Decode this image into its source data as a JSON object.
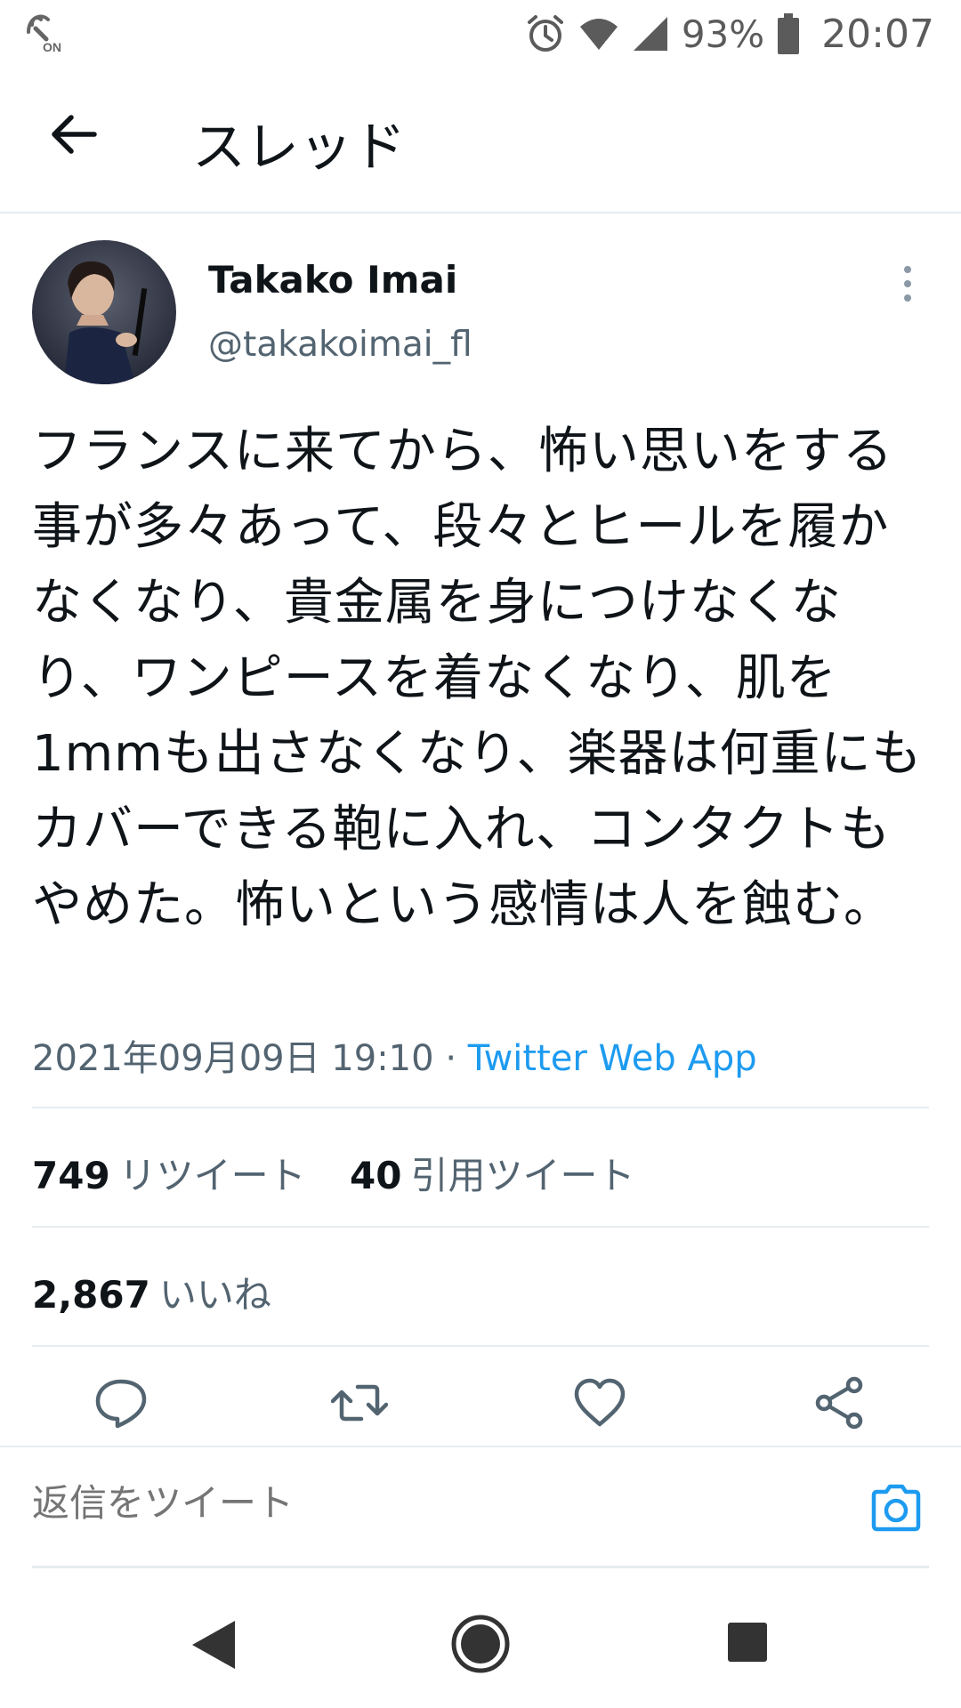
{
  "status_bar": {
    "battery": "93%",
    "time": "20:07",
    "icons": [
      "nfc-icon",
      "alarm-icon",
      "wifi-icon",
      "signal-icon",
      "battery-icon"
    ]
  },
  "header": {
    "title": "スレッド",
    "back_icon": "arrow-left-icon"
  },
  "tweet": {
    "author_name": "Takako Imai",
    "author_handle": "@takakoimai_fl",
    "text": "フランスに来てから、怖い思いをする事が多々あって、段々とヒールを履かなくなり、貴金属を身につけなくなり、ワンピースを着なくなり、肌を1mmも出さなくなり、楽器は何重にもカバーできる鞄に入れ、コンタクトもやめた。怖いという感情は人を蝕む。",
    "timestamp": "2021年09月09日 19:10",
    "separator": "·",
    "source": "Twitter Web App"
  },
  "stats": {
    "retweets_count": "749",
    "retweets_label": "リツイート",
    "quotes_count": "40",
    "quotes_label": "引用ツイート",
    "likes_count": "2,867",
    "likes_label": "いいね"
  },
  "reply": {
    "placeholder": "返信をツイート"
  },
  "colors": {
    "accent": "#1d9bf0",
    "secondary_text": "#536471",
    "divider": "#e6ecf0"
  }
}
